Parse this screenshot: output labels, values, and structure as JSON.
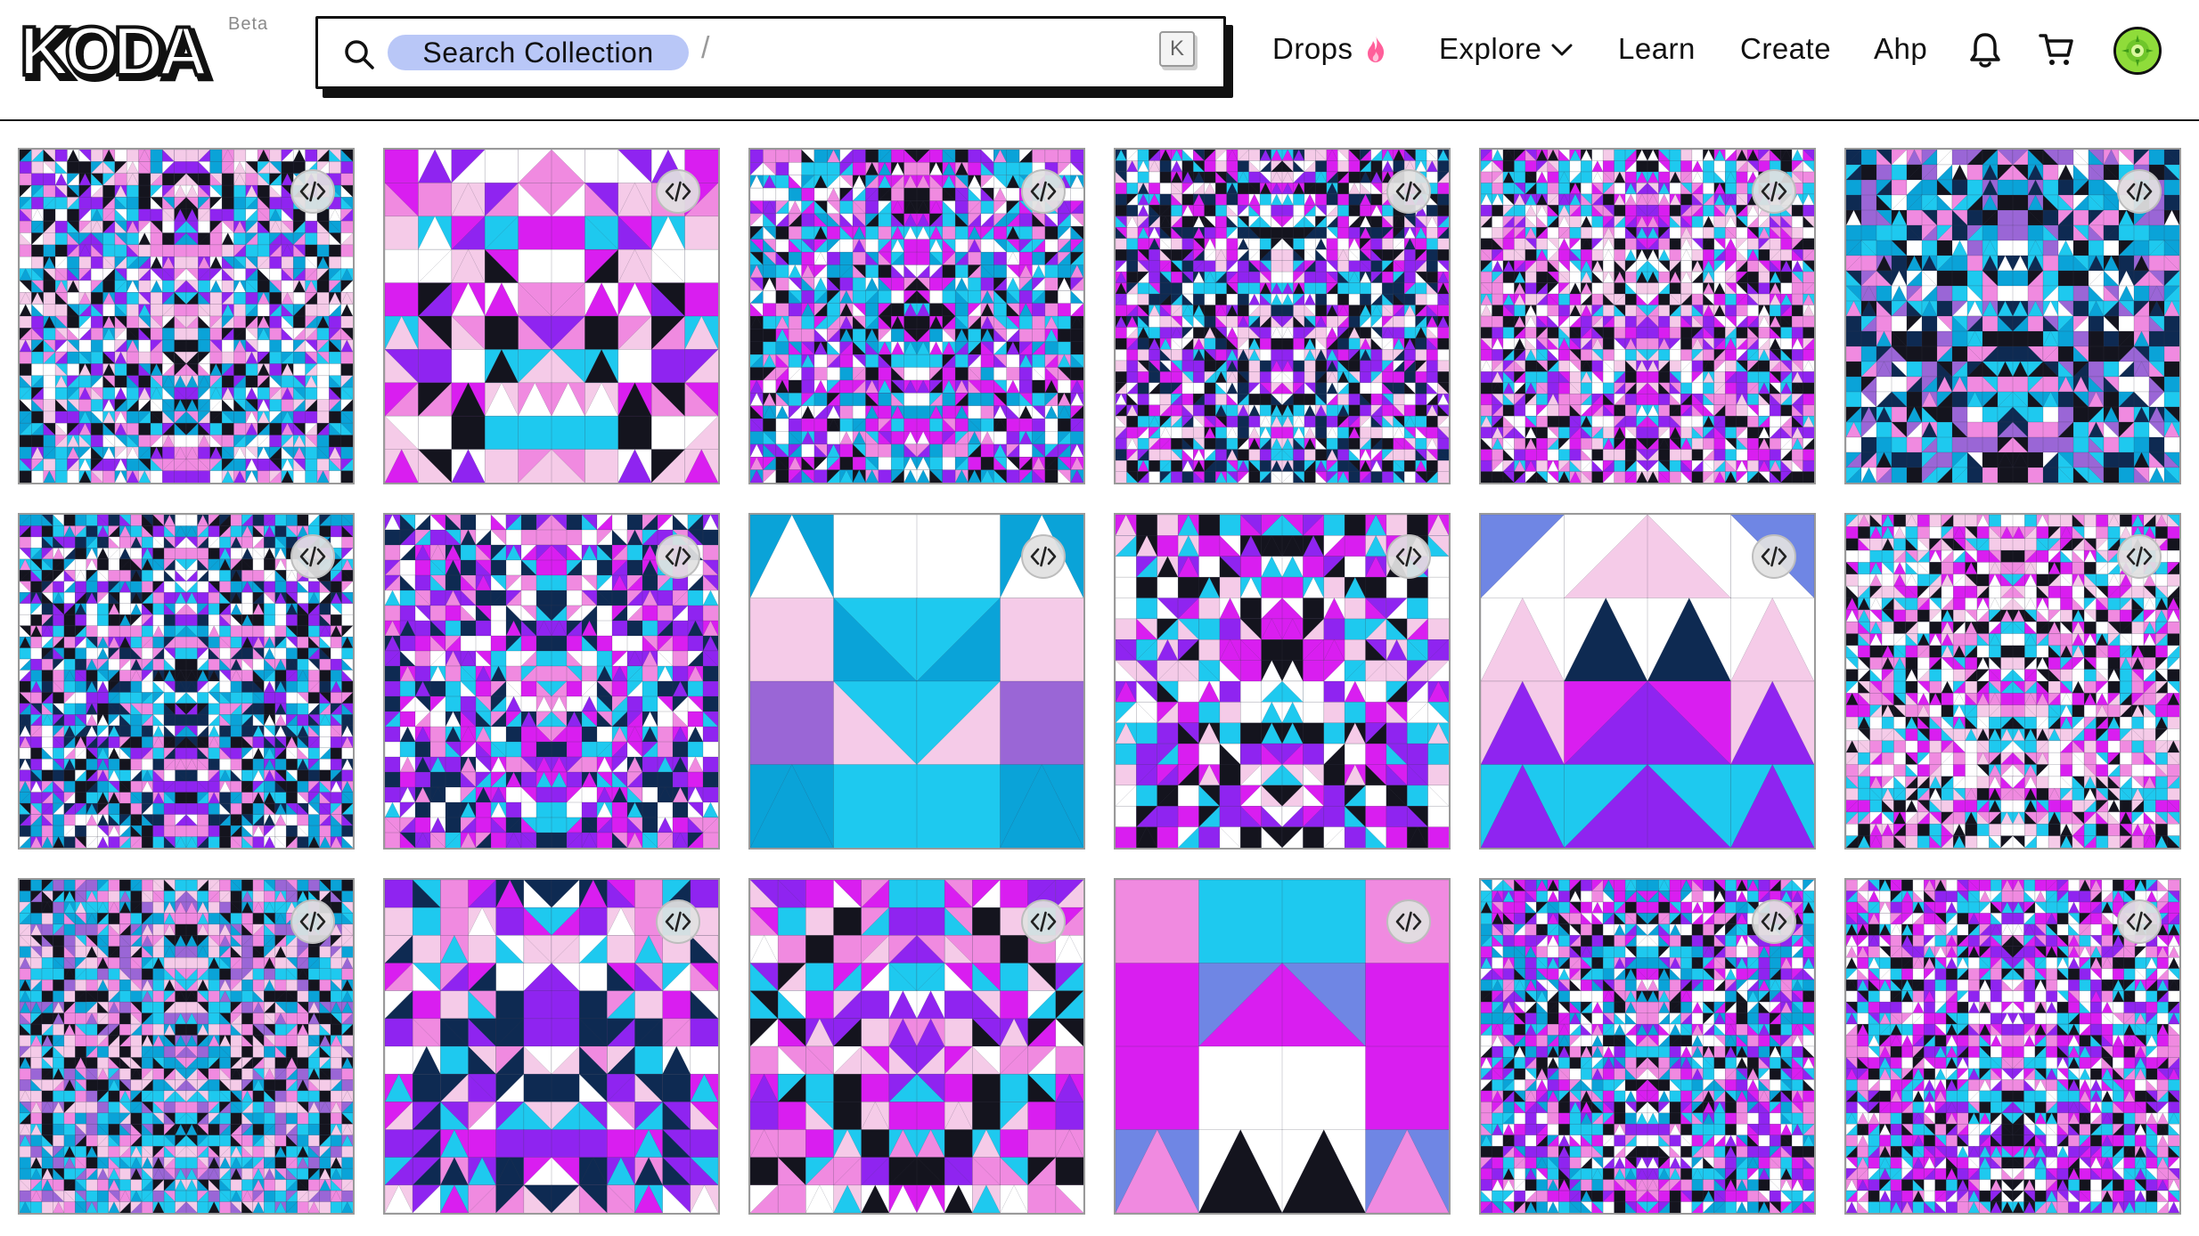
{
  "header": {
    "logo_text": "KODA",
    "beta_label": "Beta",
    "search": {
      "chip_label": "Search Collection",
      "slash": "/",
      "shortcut_key": "K"
    },
    "nav": {
      "drops": "Drops",
      "explore": "Explore",
      "learn": "Learn",
      "create": "Create",
      "user": "Ahp"
    },
    "icons": [
      "search-icon",
      "flame-icon",
      "chevron-down-icon",
      "bell-icon",
      "cart-icon",
      "avatar"
    ]
  },
  "palette": {
    "cyan": "#1ec9ef",
    "blue": "#0aa3d8",
    "magenta": "#d91ef0",
    "purple": "#8f24f0",
    "violet": "#9a66d6",
    "pink": "#f08ae0",
    "light_pink": "#f5cbe8",
    "navy": "#0e2a52",
    "black": "#14141e",
    "white": "#ffffff",
    "periwinkle": "#6f86e4",
    "accent_search": "#b9c7f7"
  },
  "gallery": {
    "columns": 6,
    "rows": 3,
    "badge_icon": "code-icon",
    "items": [
      {
        "density": 28,
        "seed": 11,
        "scheme": [
          "#f08ae0",
          "#1ec9ef",
          "#14141e",
          "#ffffff",
          "#8f24f0",
          "#f5cbe8",
          "#0aa3d8"
        ]
      },
      {
        "density": 10,
        "seed": 23,
        "scheme": [
          "#1ec9ef",
          "#14141e",
          "#f5cbe8",
          "#8f24f0",
          "#ffffff",
          "#f08ae0",
          "#d91ef0"
        ]
      },
      {
        "density": 26,
        "seed": 37,
        "scheme": [
          "#d91ef0",
          "#1ec9ef",
          "#14141e",
          "#ffffff",
          "#8f24f0",
          "#f08ae0",
          "#0aa3d8"
        ]
      },
      {
        "density": 30,
        "seed": 41,
        "scheme": [
          "#8f24f0",
          "#1ec9ef",
          "#14141e",
          "#f5cbe8",
          "#ffffff",
          "#d91ef0",
          "#0e2a52"
        ]
      },
      {
        "density": 30,
        "seed": 53,
        "scheme": [
          "#d91ef0",
          "#f08ae0",
          "#1ec9ef",
          "#14141e",
          "#8f24f0",
          "#f5cbe8",
          "#ffffff"
        ]
      },
      {
        "density": 22,
        "seed": 67,
        "scheme": [
          "#1ec9ef",
          "#0aa3d8",
          "#ffffff",
          "#9a66d6",
          "#f08ae0",
          "#0e2a52",
          "#14141e"
        ]
      },
      {
        "density": 30,
        "seed": 71,
        "scheme": [
          "#0aa3d8",
          "#14141e",
          "#f08ae0",
          "#8f24f0",
          "#1ec9ef",
          "#ffffff",
          "#0e2a52"
        ]
      },
      {
        "density": 22,
        "seed": 83,
        "scheme": [
          "#8f24f0",
          "#1ec9ef",
          "#0e2a52",
          "#ffffff",
          "#f08ae0",
          "#d91ef0"
        ]
      },
      {
        "density": 4,
        "seed": 97,
        "scheme": [
          "#9a66d6",
          "#1ec9ef",
          "#f08ae0",
          "#f5cbe8",
          "#ffffff",
          "#0aa3d8",
          "#2ee6f5"
        ]
      },
      {
        "density": 16,
        "seed": 101,
        "scheme": [
          "#d91ef0",
          "#1ec9ef",
          "#14141e",
          "#ffffff",
          "#8f24f0",
          "#f5cbe8"
        ]
      },
      {
        "density": 4,
        "seed": 113,
        "scheme": [
          "#1ec9ef",
          "#ffffff",
          "#0e2a52",
          "#6f86e4",
          "#8f24f0",
          "#f5cbe8",
          "#d91ef0"
        ]
      },
      {
        "density": 28,
        "seed": 127,
        "scheme": [
          "#f08ae0",
          "#d91ef0",
          "#14141e",
          "#1ec9ef",
          "#ffffff",
          "#f5cbe8"
        ]
      },
      {
        "density": 30,
        "seed": 131,
        "scheme": [
          "#1ec9ef",
          "#14141e",
          "#f08ae0",
          "#9a66d6",
          "#0aa3d8",
          "#f5cbe8"
        ]
      },
      {
        "density": 12,
        "seed": 149,
        "scheme": [
          "#f5cbe8",
          "#8f24f0",
          "#f08ae0",
          "#1ec9ef",
          "#ffffff",
          "#0e2a52",
          "#d91ef0"
        ]
      },
      {
        "density": 12,
        "seed": 151,
        "scheme": [
          "#d91ef0",
          "#f08ae0",
          "#ffffff",
          "#1ec9ef",
          "#8f24f0",
          "#14141e",
          "#f5cbe8"
        ]
      },
      {
        "density": 4,
        "seed": 163,
        "scheme": [
          "#1ec9ef",
          "#6f86e4",
          "#d91ef0",
          "#14141e",
          "#f5cbe8",
          "#ffffff",
          "#f08ae0"
        ]
      },
      {
        "density": 30,
        "seed": 179,
        "scheme": [
          "#8f24f0",
          "#1ec9ef",
          "#ffffff",
          "#d91ef0",
          "#14141e",
          "#f08ae0",
          "#0aa3d8"
        ]
      },
      {
        "density": 30,
        "seed": 181,
        "scheme": [
          "#f08ae0",
          "#d91ef0",
          "#1ec9ef",
          "#ffffff",
          "#14141e",
          "#8f24f0"
        ]
      }
    ]
  }
}
